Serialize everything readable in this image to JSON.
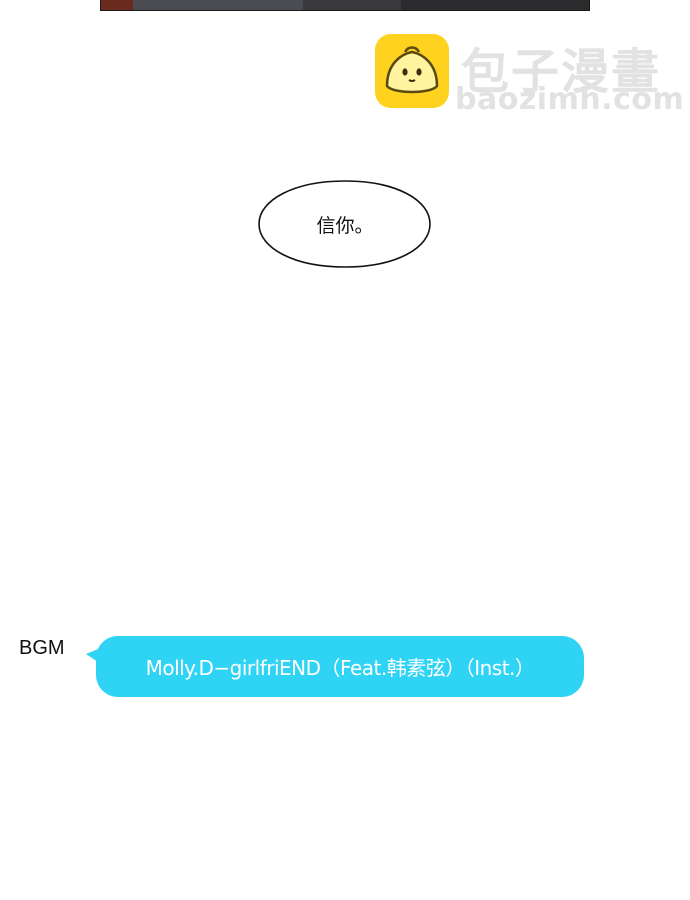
{
  "watermark": {
    "title": "包子漫畫",
    "url": "baozimh.com",
    "icon": "steamed-bun-icon",
    "icon_color": "#ffd21f"
  },
  "speech_bubble": {
    "text": "信你。"
  },
  "bgm": {
    "label": "BGM",
    "song": "Molly.D−girlfriEND（Feat.韩素弦）（Inst.）",
    "accent": "#2fd4f5"
  }
}
